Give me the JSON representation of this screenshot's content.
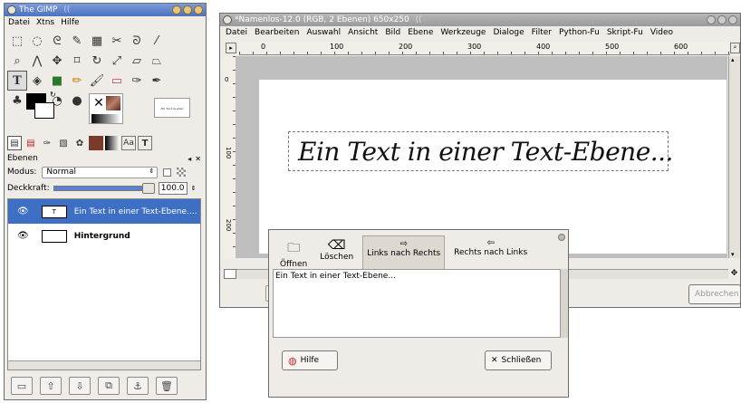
{
  "toolbox": {
    "title": "The GIMP",
    "title_suffix": "((",
    "menu": [
      "Datei",
      "Xtns",
      "Hilfe"
    ],
    "tools": [
      "rect-select",
      "ellipse-select",
      "free-select",
      "fuzzy-select",
      "color-select",
      "scissors",
      "paths",
      "color-picker",
      "zoom",
      "measure",
      "move",
      "crop",
      "rotate",
      "scale",
      "shear",
      "perspective",
      "text",
      "bucket-fill",
      "blend",
      "pencil",
      "paintbrush",
      "eraser",
      "airbrush",
      "ink",
      "clone",
      "smudge",
      "dodge-burn",
      "convolve"
    ],
    "pattern_preview_text": "ƐƖn Ƭext in einer"
  },
  "layers_dock": {
    "tabs": [
      "layers-tab",
      "channels-tab",
      "paths-tab",
      "undo-tab",
      "brushes-tab",
      "patterns-tab",
      "gradients-tab",
      "fonts-tab",
      "text-tab"
    ],
    "title": "Ebenen",
    "mode_label": "Modus:",
    "mode_value": "Normal",
    "opacity_label": "Deckkraft:",
    "opacity_value": "100.0",
    "layers": [
      {
        "name": "Ein Text in einer Text-Ebene....",
        "selected": true,
        "is_text": true
      },
      {
        "name": "Hintergrund",
        "selected": false,
        "is_text": false
      }
    ]
  },
  "image_window": {
    "title": "*Namenlos-12.0 (RGB, 2 Ebenen) 650x250",
    "title_suffix": "((",
    "menu": [
      "Datei",
      "Bearbeiten",
      "Auswahl",
      "Ansicht",
      "Bild",
      "Ebene",
      "Werkzeuge",
      "Dialoge",
      "Filter",
      "Python-Fu",
      "Skript-Fu",
      "Video"
    ],
    "ruler_labels": [
      "0",
      "100",
      "200",
      "300",
      "400",
      "500",
      "600"
    ],
    "vruler_labels": [
      "0",
      "100",
      "200"
    ],
    "canvas_text": "Ein Text in einer Text-Ebene...",
    "cancel_label": "Abbrechen"
  },
  "text_editor": {
    "buttons": [
      {
        "label": "Öffnen",
        "icon": "folder-icon"
      },
      {
        "label": "Löschen",
        "icon": "clear-icon"
      },
      {
        "label": "Links nach Rechts",
        "icon": "ltr-icon",
        "active": true
      },
      {
        "label": "Rechts nach Links",
        "icon": "rtl-icon"
      }
    ],
    "content": "Ein Text in einer Text-Ebene...",
    "help_label": "Hilfe",
    "close_label": "Schließen"
  }
}
